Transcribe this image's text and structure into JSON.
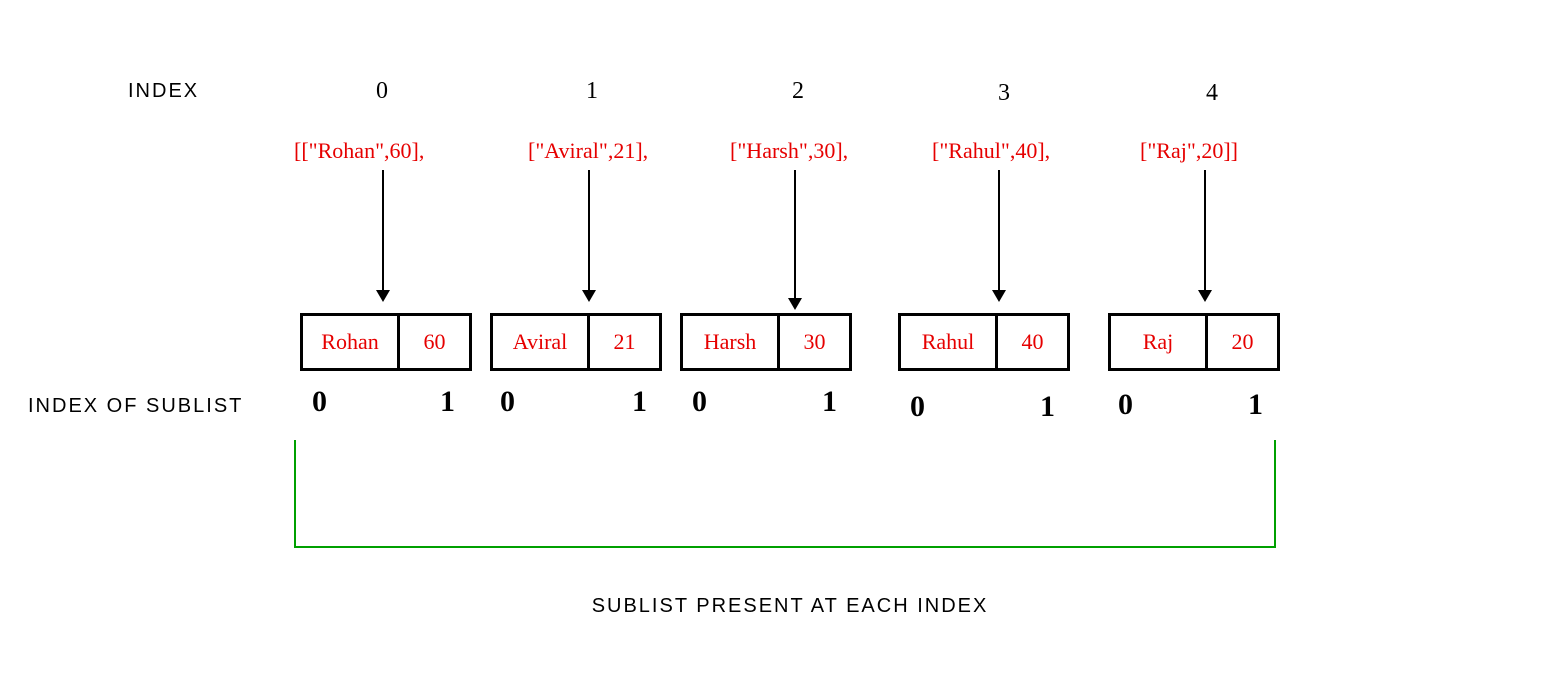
{
  "labels": {
    "index": "INDEX",
    "index_of_sublist": "INDEX OF SUBLIST",
    "caption": "SUBLIST PRESENT AT EACH INDEX"
  },
  "columns": [
    {
      "index": "0",
      "code": "[[\"Rohan\",60],",
      "name": "Rohan",
      "value": "60",
      "sub0": "0",
      "sub1": "1"
    },
    {
      "index": "1",
      "code": "[\"Aviral\",21],",
      "name": "Aviral",
      "value": "21",
      "sub0": "0",
      "sub1": "1"
    },
    {
      "index": "2",
      "code": "[\"Harsh\",30],",
      "name": "Harsh",
      "value": "30",
      "sub0": "0",
      "sub1": "1"
    },
    {
      "index": "3",
      "code": "[\"Rahul\",40],",
      "name": "Rahul",
      "value": "40",
      "sub0": "0",
      "sub1": "1"
    },
    {
      "index": "4",
      "code": "[\"Raj\",20]]",
      "name": "Raj",
      "value": "20",
      "sub0": "0",
      "sub1": "1"
    }
  ]
}
